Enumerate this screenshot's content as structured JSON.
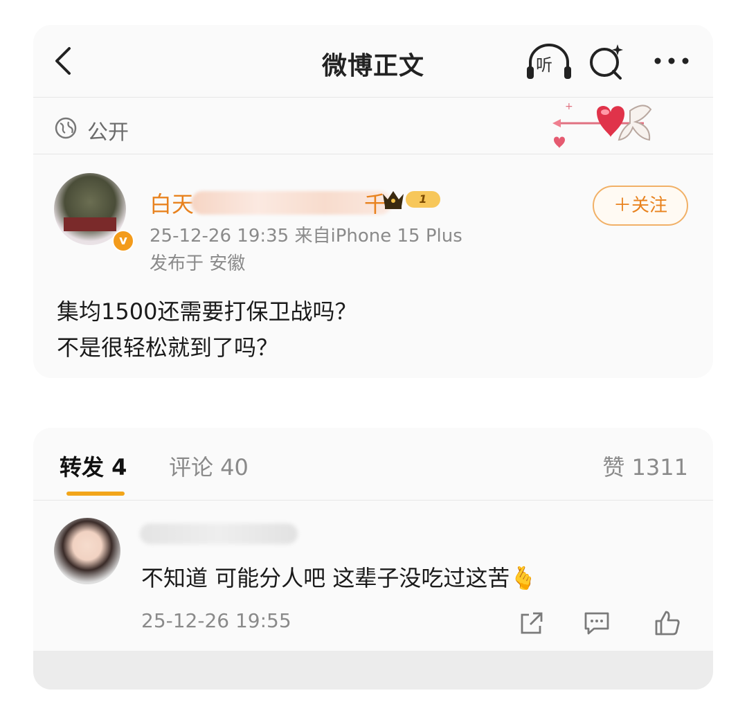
{
  "header": {
    "title": "微博正文",
    "listen_label": "听"
  },
  "visibility": {
    "label": "公开"
  },
  "post": {
    "author_name": "白天",
    "author_suffix": "千",
    "level": "1",
    "meta": "25-12-26 19:35  来自iPhone 15 Plus",
    "location": "发布于 安徽",
    "follow_label": "＋关注",
    "lines": [
      "集均1500还需要打保卫战吗？",
      "不是很轻松就到了吗？"
    ]
  },
  "tabs": {
    "reposts": "转发 4",
    "comments": "评论 40",
    "likes": "赞 1311"
  },
  "comment": {
    "text": "不知道 可能分人吧 这辈子没吃过这苦🫰",
    "time": "25-12-26 19:55"
  },
  "colors": {
    "accent": "#e8821e",
    "tab_indicator": "#f2a51a",
    "verified": "#f39b1b"
  },
  "icons": [
    "back-icon",
    "listen-icon",
    "search-icon",
    "more-icon",
    "globe-icon",
    "crown-icon",
    "share-icon",
    "reply-icon",
    "like-icon"
  ]
}
